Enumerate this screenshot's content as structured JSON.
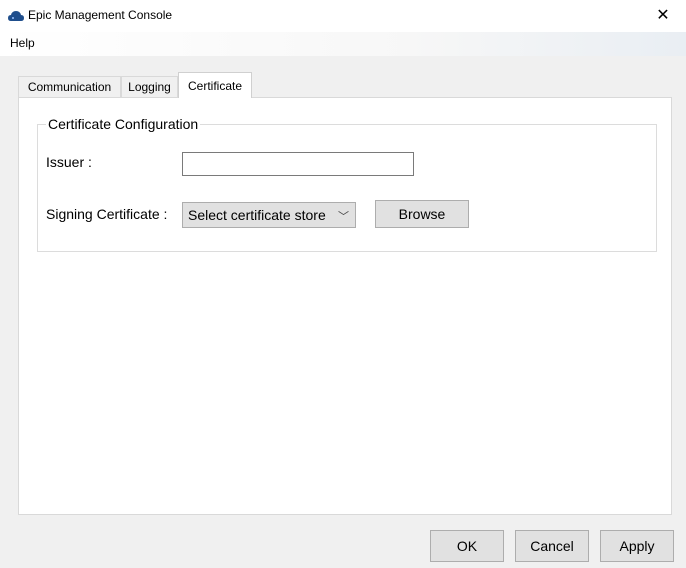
{
  "window": {
    "title": "Epic Management Console",
    "close_glyph": "✕",
    "app_icon": "cloud-icon"
  },
  "menu": {
    "items": [
      "Help"
    ]
  },
  "tabs": [
    {
      "label": "Communication",
      "selected": false
    },
    {
      "label": "Logging",
      "selected": false
    },
    {
      "label": "Certificate",
      "selected": true
    }
  ],
  "certificate_group": {
    "title": "Certificate Configuration",
    "issuer_label": "Issuer :",
    "issuer_value": "",
    "signing_label": "Signing Certificate :",
    "store_select": {
      "value": "Select certificate store",
      "chevron": "﹀"
    },
    "browse_label": "Browse"
  },
  "footer": {
    "ok_label": "OK",
    "cancel_label": "Cancel",
    "apply_label": "Apply"
  }
}
